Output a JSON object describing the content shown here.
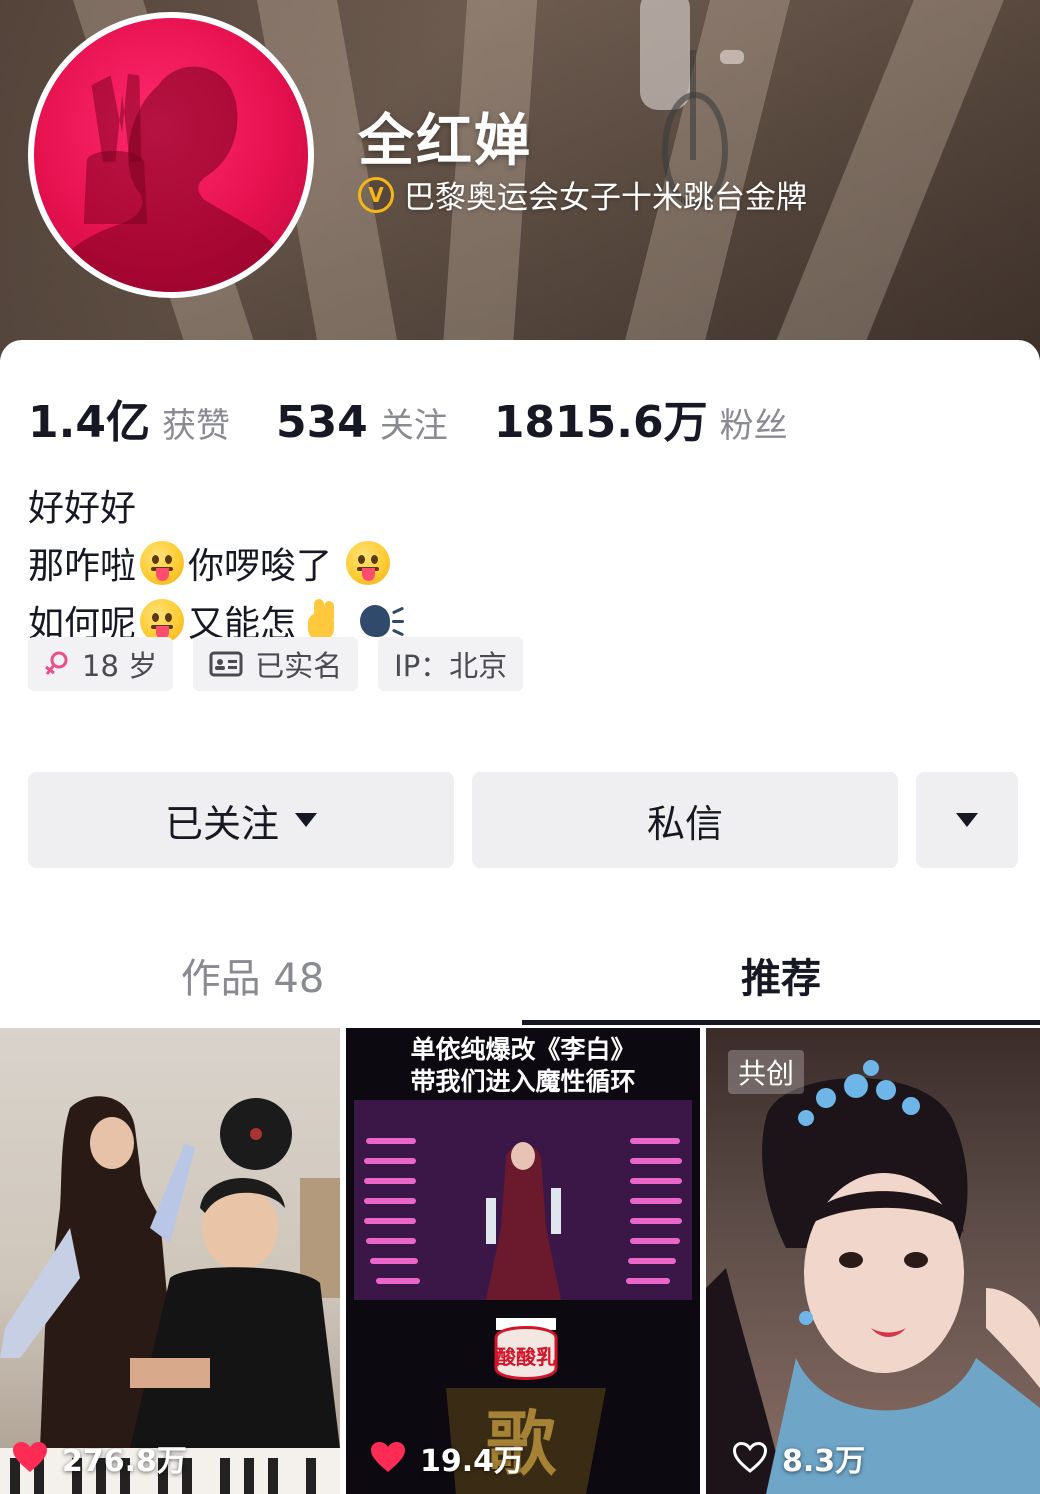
{
  "profile": {
    "name": "全红婵",
    "verification": "巴黎奥运会女子十米跳台金牌"
  },
  "stats": [
    {
      "value": "1.4亿",
      "label": "获赞"
    },
    {
      "value": "534",
      "label": "关注"
    },
    {
      "value": "1815.6万",
      "label": "粉丝"
    }
  ],
  "bio": {
    "line1": "好好好",
    "line2_a": "那咋啦",
    "line2_b": "你啰唆了",
    "line3_a": "如何呢",
    "line3_b": "又能怎"
  },
  "tags": {
    "age": "18 岁",
    "realname": "已实名",
    "ip": "IP：北京"
  },
  "actions": {
    "follow": "已关注",
    "message": "私信"
  },
  "tabs": {
    "works_label": "作品 48",
    "recommend_label": "推荐",
    "active": "推荐"
  },
  "videos": [
    {
      "likes": "276.8万"
    },
    {
      "title_line1": "单依纯爆改《李白》",
      "title_line2": "带我们进入魔性循环",
      "likes": "19.4万"
    },
    {
      "badge": "共创",
      "likes": "8.3万"
    }
  ],
  "colors": {
    "accent_gold": "#f5b616",
    "like_red": "#fe2c55",
    "text_primary": "#161823",
    "text_secondary": "#8a8b91"
  }
}
